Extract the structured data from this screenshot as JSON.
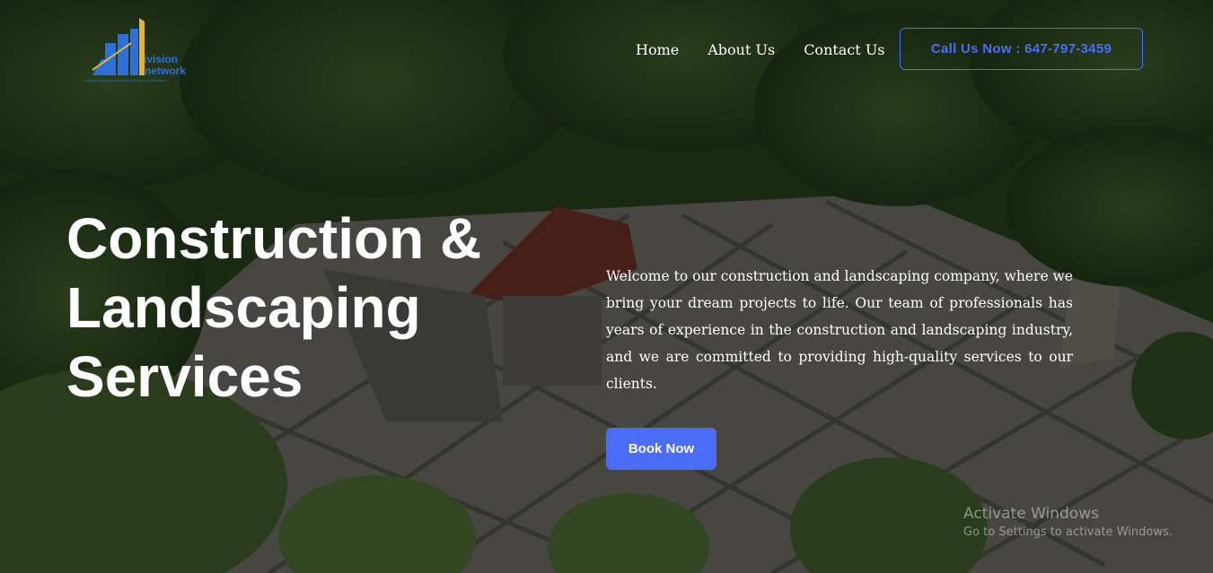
{
  "logo": {
    "line1": "ivision",
    "line2": "network",
    "tagline": "Building Bright Ideas and Better Future for Everyone"
  },
  "nav": {
    "items": [
      {
        "label": "Home"
      },
      {
        "label": "About Us"
      },
      {
        "label": "Contact Us"
      }
    ],
    "call_label": "Call Us Now : 647-797-3459"
  },
  "hero": {
    "title": "Construction & Landscaping Services",
    "intro": "Welcome to our construction and landscaping company, where we bring your dream projects to life. Our team of professionals has years of experience in the construction and landscaping industry, and we are committed to providing high-quality services to our clients.",
    "cta_label": "Book Now"
  },
  "watermark": {
    "title": "Activate Windows",
    "subtitle": "Go to Settings to activate Windows."
  },
  "colors": {
    "accent": "#4a6cf7",
    "text": "#ffffff",
    "logo_blue": "#2f6fd8",
    "logo_gold": "#e3b23c"
  }
}
